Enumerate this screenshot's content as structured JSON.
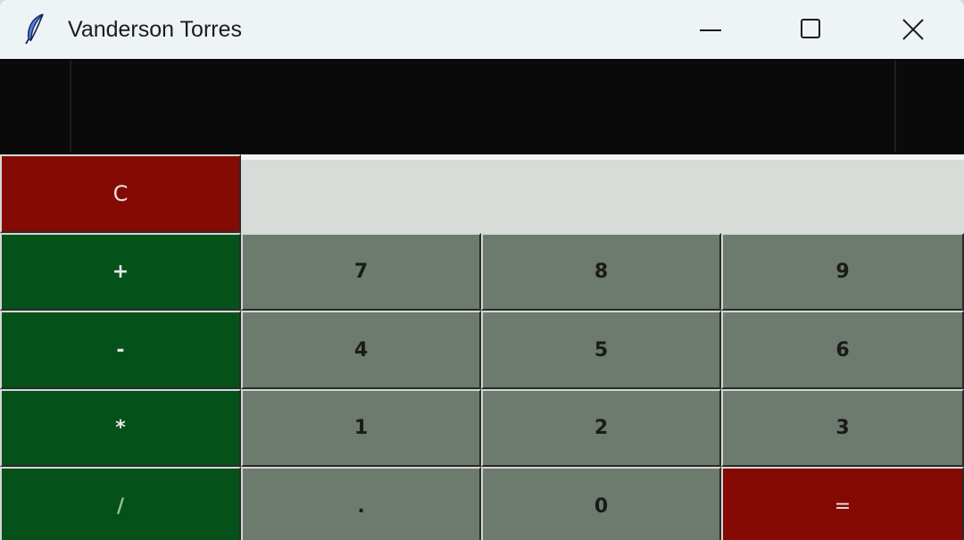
{
  "window": {
    "title": "Vanderson Torres",
    "app_icon": "feather-icon",
    "controls": {
      "minimize_icon": "minimize-icon",
      "maximize_icon": "maximize-icon",
      "close_icon": "close-icon"
    }
  },
  "display": {
    "value": ""
  },
  "buttons": {
    "clear": "C",
    "add": "+",
    "subtract": "-",
    "multiply": "*",
    "divide": "/",
    "seven": "7",
    "eight": "8",
    "nine": "9",
    "four": "4",
    "five": "5",
    "six": "6",
    "one": "1",
    "two": "2",
    "three": "3",
    "decimal": ".",
    "zero": "0",
    "equals": "="
  },
  "colors": {
    "clear_bg": "#850a04",
    "operator_bg": "#04521a",
    "number_bg": "#6d7a6e",
    "equals_bg": "#850a04",
    "display_bg": "#0a0a0a",
    "titlebar_bg": "#eef4f6"
  }
}
